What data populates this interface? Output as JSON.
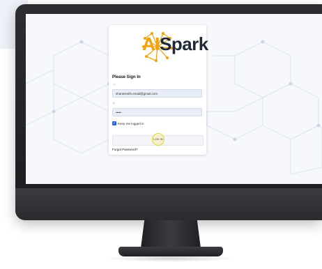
{
  "brand": {
    "prefix": "AI",
    "suffix": "Spark"
  },
  "login": {
    "title": "Please Sign In",
    "email_value": "shanesmith.email@gmail.com",
    "password_value": "•••••",
    "remember_label": "Keep me logged in",
    "login_button": "LOG IN",
    "forgot_password": "Forgot Password?"
  },
  "colors": {
    "accent": "#f2a20c",
    "checkbox": "#2563eb",
    "input_bg": "#e8edf7"
  },
  "icons": {
    "email": "user-icon",
    "password": "lock-icon",
    "logo": "spark-network-icon"
  }
}
